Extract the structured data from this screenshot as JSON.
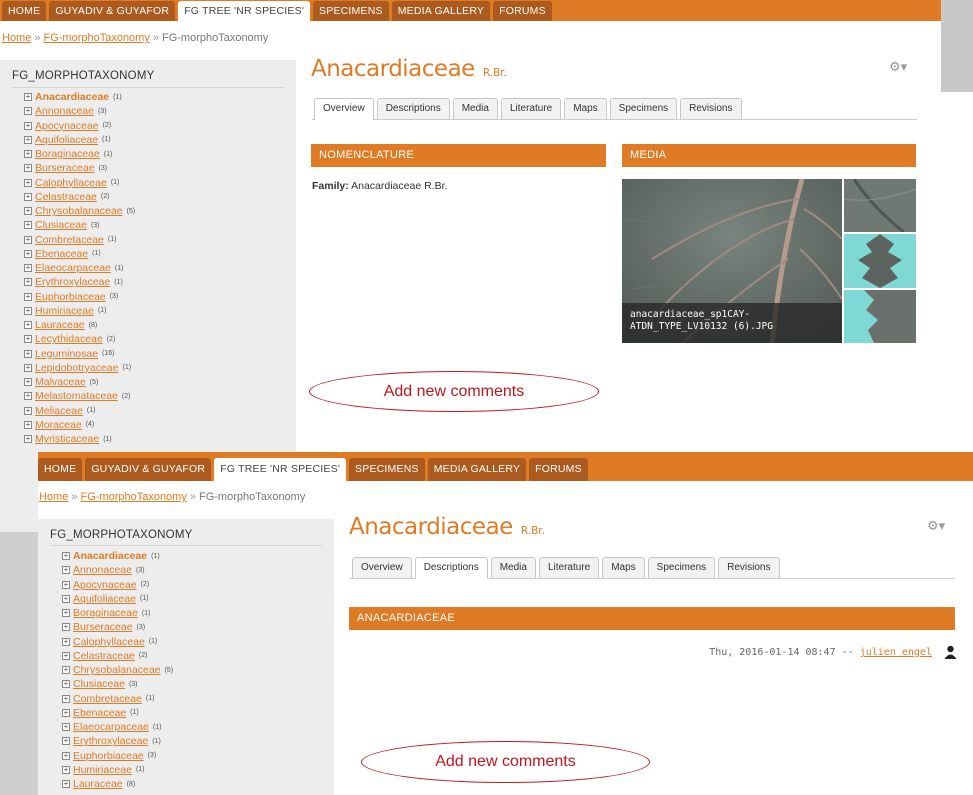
{
  "nav": [
    "HOME",
    "GUYADIV & GUYAFOR",
    "FG TREE 'NR SPECIES'",
    "SPECIMENS",
    "MEDIA GALLERY",
    "FORUMS"
  ],
  "nav_active_index": 2,
  "breadcrumb": {
    "home": "Home",
    "sep": "»",
    "parent": "FG-morphoTaxonomy",
    "current": "FG-morphoTaxonomy"
  },
  "sidebar": {
    "title": "FG_MORPHOTAXONOMY",
    "expander": "+",
    "items": [
      {
        "name": "Anacardiaceae",
        "count": "(1)"
      },
      {
        "name": "Annonaceae",
        "count": "(3)"
      },
      {
        "name": "Apocynaceae",
        "count": "(2)"
      },
      {
        "name": "Aquifoliaceae",
        "count": "(1)"
      },
      {
        "name": "Boraginaceae",
        "count": "(1)"
      },
      {
        "name": "Burseraceae",
        "count": "(3)"
      },
      {
        "name": "Calophyllaceae",
        "count": "(1)"
      },
      {
        "name": "Celastraceae",
        "count": "(2)"
      },
      {
        "name": "Chrysobalanaceae",
        "count": "(5)"
      },
      {
        "name": "Clusiaceae",
        "count": "(3)"
      },
      {
        "name": "Combretaceae",
        "count": "(1)"
      },
      {
        "name": "Ebenaceae",
        "count": "(1)"
      },
      {
        "name": "Elaeocarpaceae",
        "count": "(1)"
      },
      {
        "name": "Erythroxylaceae",
        "count": "(1)"
      },
      {
        "name": "Euphorbiaceae",
        "count": "(3)"
      },
      {
        "name": "Humiriaceae",
        "count": "(1)"
      },
      {
        "name": "Lauraceae",
        "count": "(8)"
      },
      {
        "name": "Lecythidaceae",
        "count": "(2)"
      },
      {
        "name": "Leguminosae",
        "count": "(16)"
      },
      {
        "name": "Lepidobotryaceae",
        "count": "(1)"
      },
      {
        "name": "Malvaceae",
        "count": "(5)"
      },
      {
        "name": "Melastomataceae",
        "count": "(2)"
      },
      {
        "name": "Meliaceae",
        "count": "(1)"
      },
      {
        "name": "Moraceae",
        "count": "(4)"
      },
      {
        "name": "Myristicaceae",
        "count": "(1)"
      }
    ]
  },
  "page": {
    "title": "Anacardiaceae",
    "author": "R.Br.",
    "gear": "⚙▾"
  },
  "tabs": [
    "Overview",
    "Descriptions",
    "Media",
    "Literature",
    "Maps",
    "Specimens",
    "Revisions"
  ],
  "top": {
    "active_tab": 0,
    "nomenclature_header": "NOMENCLATURE",
    "media_header": "MEDIA",
    "family_label": "Family:",
    "family_value": "Anacardiaceae R.Br.",
    "media_caption_line1": "anacardiaceae_sp1CAY-",
    "media_caption_line2": "ATDN_TYPE_LV10132 (6).JPG",
    "annotation": "Add new comments"
  },
  "bottom": {
    "active_tab": 1,
    "section_header": "ANACARDIACEAE",
    "date": "Thu, 2016-01-14 08:47",
    "dash": "--",
    "user": "julien engel",
    "annotation": "Add new comments"
  },
  "colors": {
    "accent": "#e07b25",
    "nav_dark": "#ac5a1e",
    "annotation_red": "#c0161b",
    "sidebar_bg": "#ededed"
  }
}
